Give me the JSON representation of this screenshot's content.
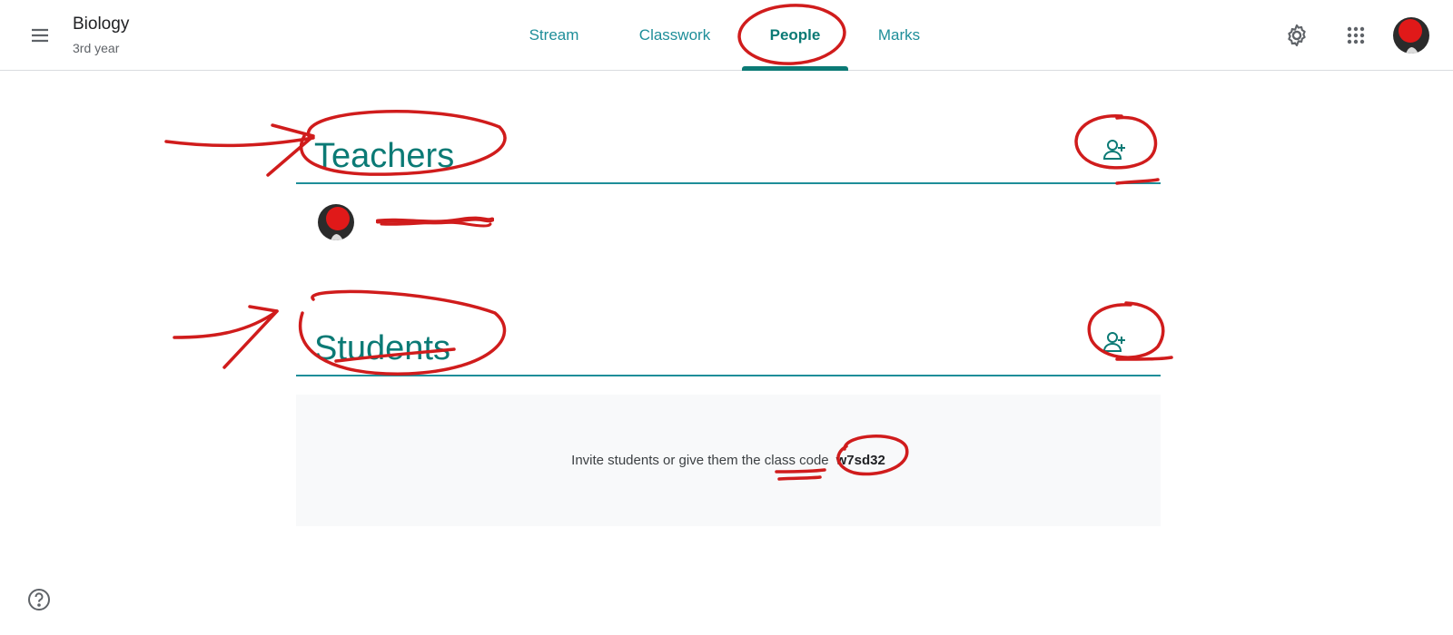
{
  "header": {
    "course_title": "Biology",
    "course_subtitle": "3rd year",
    "tabs": [
      {
        "label": "Stream"
      },
      {
        "label": "Classwork"
      },
      {
        "label": "People",
        "active": true
      },
      {
        "label": "Marks"
      }
    ],
    "icons": [
      "menu-icon",
      "settings-gear-icon",
      "apps-grid-icon",
      "account-avatar"
    ]
  },
  "teachers": {
    "title": "Teachers",
    "invite_icon": "person-add-icon",
    "members": [
      {
        "name": "",
        "name_redacted": true
      }
    ]
  },
  "students": {
    "title": "Students",
    "invite_icon": "person-add-icon",
    "invite_text": "Invite students or give them the class code",
    "class_code": "w7sd32"
  },
  "footer": {
    "help_icon": "help-icon"
  },
  "colors": {
    "accent": "#0b7a75",
    "tab_text": "#1e8e99",
    "divider": "#1e8e99",
    "annotation": "#d01c1c",
    "invite_bg": "#f8f9fa"
  }
}
